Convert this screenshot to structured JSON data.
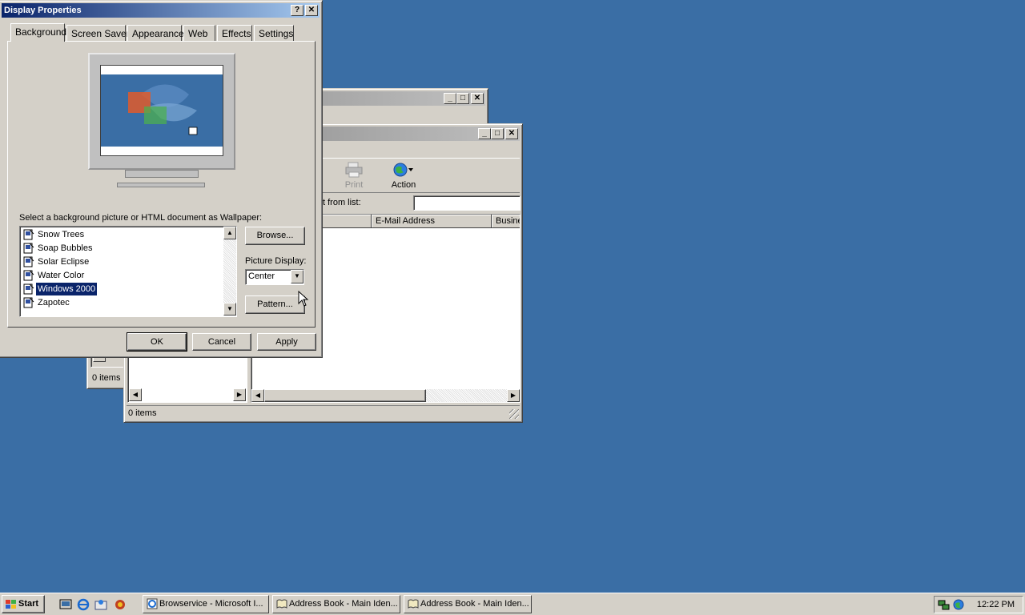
{
  "display_properties": {
    "title": "Display Properties",
    "tabs": [
      "Background",
      "Screen Saver",
      "Appearance",
      "Web",
      "Effects",
      "Settings"
    ],
    "wallpaper_prompt": "Select a background picture or HTML document as Wallpaper:",
    "wallpapers": [
      "Snow Trees",
      "Soap Bubbles",
      "Solar Eclipse",
      "Water Color",
      "Windows 2000",
      "Zapotec"
    ],
    "selected_wallpaper": "Windows 2000",
    "browse_label": "Browse...",
    "picture_display_label": "Picture Display:",
    "picture_display_value": "Center",
    "pattern_label": "Pattern...",
    "ok_label": "OK",
    "cancel_label": "Cancel",
    "apply_label": "Apply"
  },
  "address_book": {
    "toolbar": {
      "print_label": "Print",
      "action_label": "Action"
    },
    "find_label": "t from list:",
    "columns": [
      "E-Mail Address",
      "Busine"
    ],
    "status": "0 items"
  },
  "back_window": {
    "status": "0 items"
  },
  "taskbar": {
    "start_label": "Start",
    "tasks": [
      "Browservice - Microsoft I...",
      "Address Book - Main Iden...",
      "Address Book - Main Iden..."
    ],
    "clock": "12:22 PM"
  },
  "colors": {
    "desktop": "#3a6ea5",
    "selection": "#0a246a",
    "face": "#d4d0c8"
  }
}
